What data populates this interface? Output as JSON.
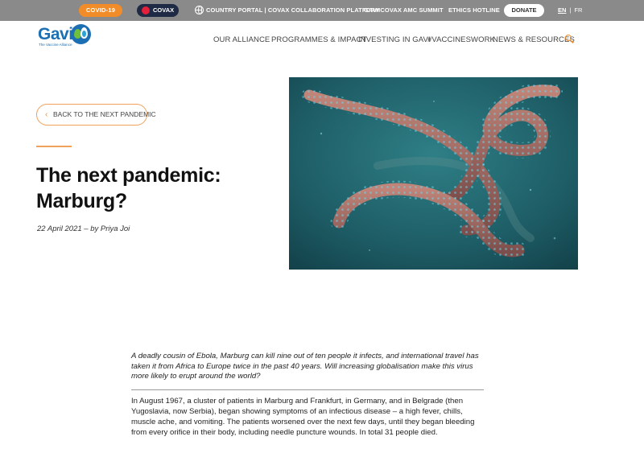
{
  "topbar": {
    "covid_label": "COVID-19",
    "covax_label": "COVAX",
    "links": [
      "COUNTRY PORTAL | COVAX COLLABORATION PLATFORM",
      "GAVI COVAX AMC SUMMIT",
      "ETHICS HOTLINE"
    ],
    "donate_label": "DONATE",
    "lang_en": "EN",
    "lang_sep": "|",
    "lang_fr": "FR"
  },
  "logo": {
    "name": "Gavi",
    "tagline": "The Vaccine Alliance"
  },
  "nav": {
    "items": [
      "OUR ALLIANCE",
      "PROGRAMMES & IMPACT",
      "INVESTING IN GAVI",
      "#VACCINESWORK",
      "NEWS & RESOURCES"
    ]
  },
  "article": {
    "back_label": "BACK TO THE NEXT PANDEMIC",
    "title": "The next pandemic: Marburg?",
    "byline": "22 April 2021 – by Priya Joi",
    "lede": "A deadly cousin of Ebola, Marburg can kill nine out of ten people it infects, and international travel has taken it from Africa to Europe twice in the past 40 years. Will increasing globalisation make this virus more likely to erupt around the world?",
    "body": "In August 1967, a cluster of patients in Marburg and Frankfurt, in Germany, and in Belgrade (then Yugoslavia, now Serbia), began showing symptoms of an infectious disease – a high fever, chills, muscle ache, and vomiting. The patients worsened over the next few days, until they began bleeding from every orifice in their body, including needle puncture wounds. In total 31 people died."
  },
  "colors": {
    "accent": "#f28c28",
    "brand_blue": "#1c6fb3",
    "topbar": "#8a8a8a",
    "covax_red": "#e4203a"
  }
}
